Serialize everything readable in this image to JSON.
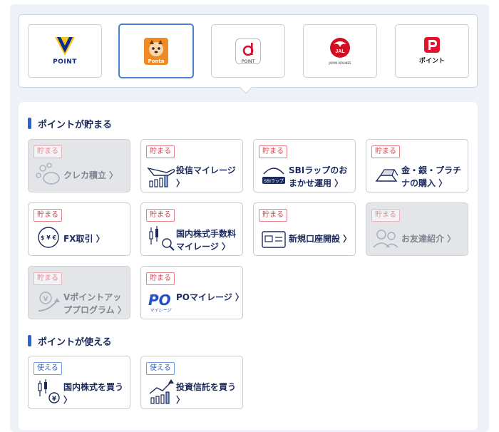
{
  "brands": [
    {
      "name": "v-point",
      "label": "POINT",
      "selected": false
    },
    {
      "name": "ponta",
      "label": "Ponta",
      "selected": true
    },
    {
      "name": "d-point",
      "label": "POINT",
      "selected": false
    },
    {
      "name": "jal",
      "label": "JAL",
      "selected": false
    },
    {
      "name": "paypay",
      "label": "ポイント",
      "selected": false
    }
  ],
  "sections": {
    "earn": {
      "title": "ポイントが貯まる"
    },
    "use": {
      "title": "ポイントが使える"
    }
  },
  "earn_tag": "貯まる",
  "use_tag": "使える",
  "earn_cards": [
    {
      "label": "クレカ積立 〉",
      "disabled": true
    },
    {
      "label": "投信マイレージ 〉",
      "disabled": false
    },
    {
      "label": "SBIラップのおまかせ運用 〉",
      "disabled": false
    },
    {
      "label": "金・銀・プラチナの購入 〉",
      "disabled": false
    },
    {
      "label": "FX取引 〉",
      "disabled": false
    },
    {
      "label": "国内株式手数料マイレージ 〉",
      "disabled": false
    },
    {
      "label": "新規口座開設 〉",
      "disabled": false
    },
    {
      "label": "お友達紹介 〉",
      "disabled": true
    },
    {
      "label": "Vポイントアッププログラム 〉",
      "disabled": true
    },
    {
      "label": "POマイレージ 〉",
      "disabled": false
    }
  ],
  "use_cards": [
    {
      "label": "国内株式を買う 〉"
    },
    {
      "label": "投資信託を買う 〉"
    }
  ],
  "icon_text": {
    "sbi_wrap": "SBIラップ",
    "po_logo": "PO",
    "po_sub": "マイレージ",
    "fx": "$ ¥ €",
    "jal_sub": "JAPAN AIRLINES",
    "yen": "¥",
    "v": "V"
  },
  "colors": {
    "accent": "#2d5fd6",
    "earn_tag": "#d6424f",
    "use_tag": "#2f64c8",
    "text": "#1b2a5a"
  }
}
